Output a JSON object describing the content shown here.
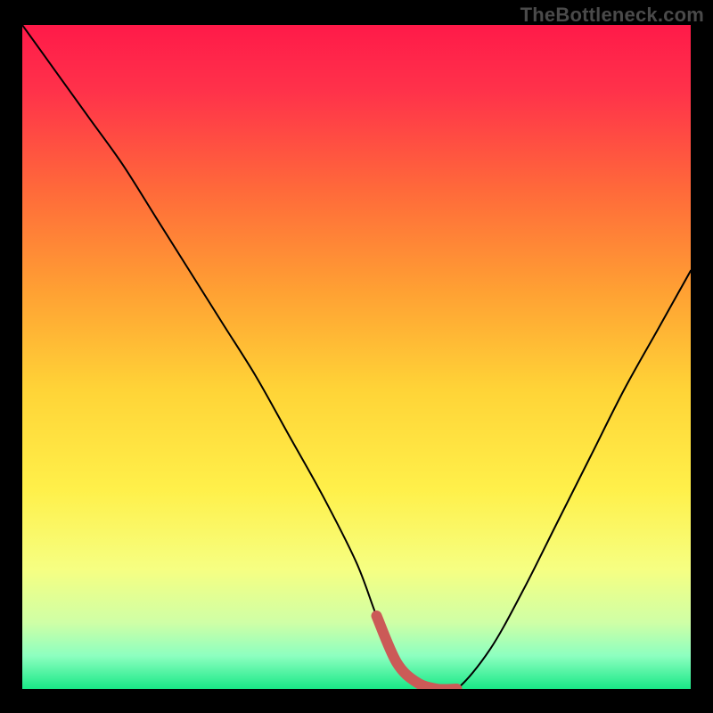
{
  "watermark": "TheBottleneck.com",
  "colors": {
    "frame": "#000000",
    "watermark": "#4a4a4a",
    "curve": "#000000",
    "highlight": "#cb5a57",
    "gradient_stops": [
      {
        "offset": 0.0,
        "color": "#ff1a49"
      },
      {
        "offset": 0.1,
        "color": "#ff324a"
      },
      {
        "offset": 0.25,
        "color": "#ff6a3a"
      },
      {
        "offset": 0.4,
        "color": "#ffa033"
      },
      {
        "offset": 0.55,
        "color": "#ffd437"
      },
      {
        "offset": 0.7,
        "color": "#fff04a"
      },
      {
        "offset": 0.82,
        "color": "#f6ff82"
      },
      {
        "offset": 0.9,
        "color": "#cfffa6"
      },
      {
        "offset": 0.95,
        "color": "#8dffc0"
      },
      {
        "offset": 1.0,
        "color": "#19e887"
      }
    ]
  },
  "chart_data": {
    "type": "line",
    "title": "",
    "xlabel": "",
    "ylabel": "",
    "xlim": [
      0,
      100
    ],
    "ylim": [
      0,
      100
    ],
    "legend": false,
    "grid": false,
    "series": [
      {
        "name": "bottleneck-curve",
        "x": [
          0,
          5,
          10,
          15,
          20,
          25,
          30,
          35,
          40,
          45,
          50,
          53,
          56,
          59,
          62,
          65,
          70,
          75,
          80,
          85,
          90,
          95,
          100
        ],
        "values": [
          100,
          93,
          86,
          79,
          71,
          63,
          55,
          47,
          38,
          29,
          19,
          11,
          4,
          1,
          0,
          0,
          6,
          15,
          25,
          35,
          45,
          54,
          63
        ]
      }
    ],
    "highlight_segment": {
      "series": "bottleneck-curve",
      "x_start": 53,
      "x_end": 65,
      "note": "flat-bottom sweet-spot region drawn thick in muted red"
    }
  }
}
